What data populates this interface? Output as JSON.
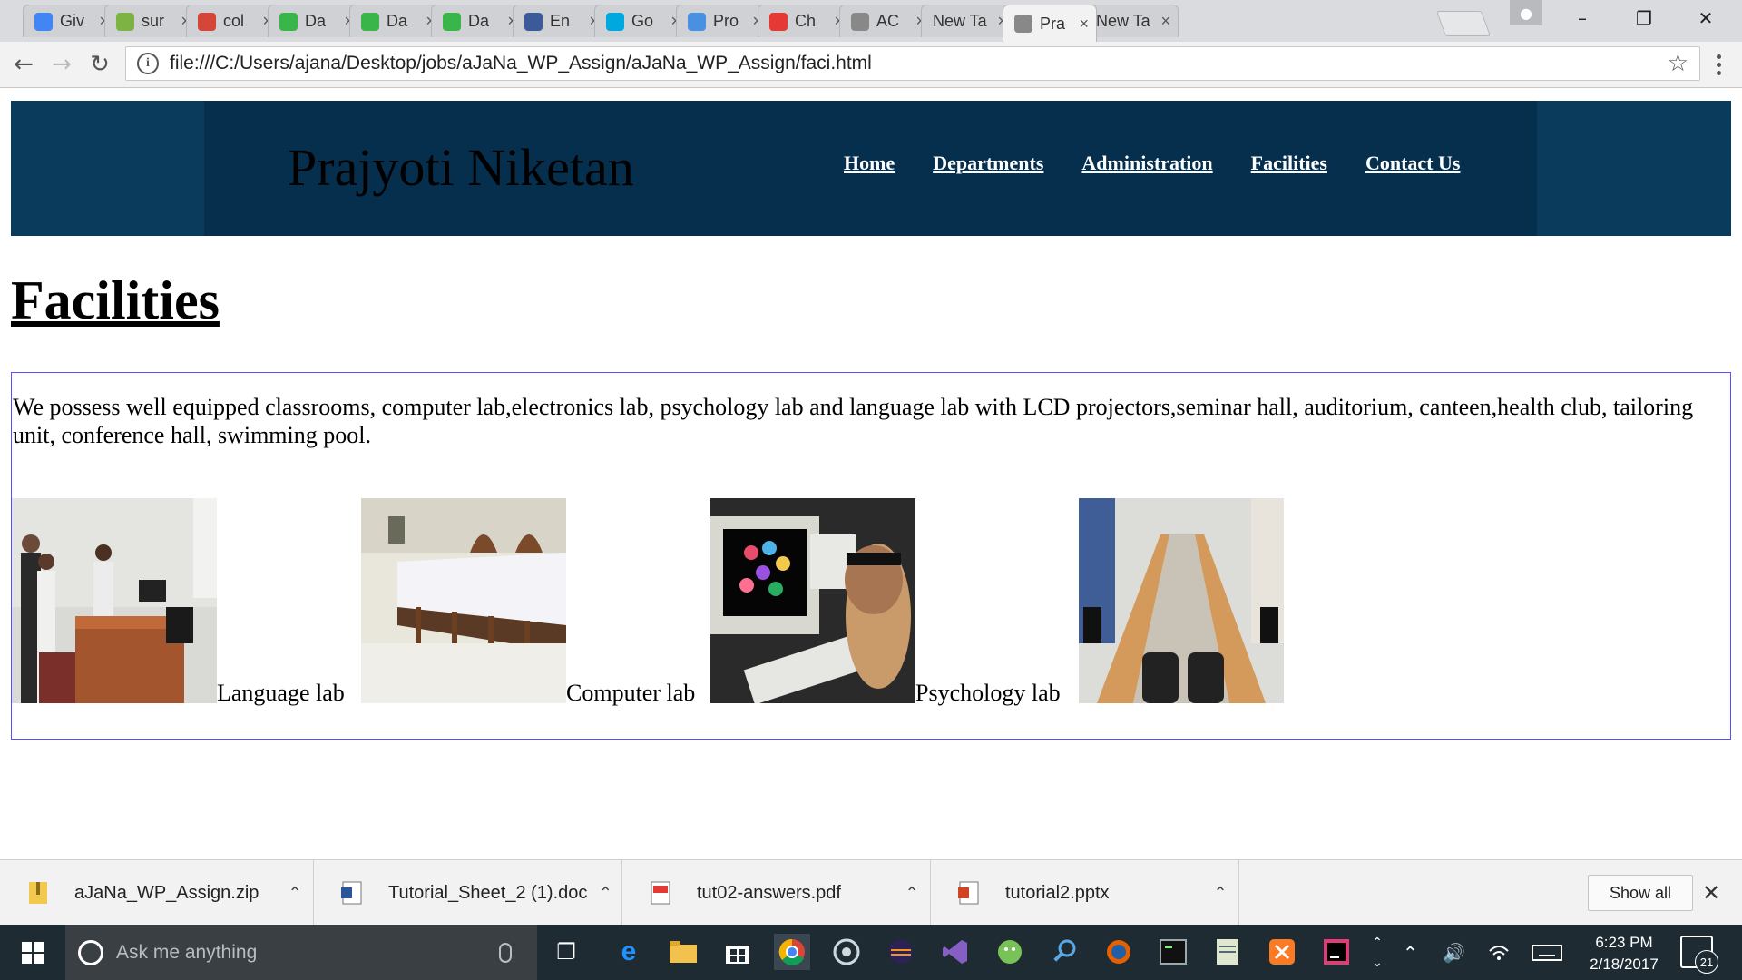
{
  "browser": {
    "tabs": [
      {
        "label": "Giv",
        "icon": "google-icon",
        "color": "#4285f4"
      },
      {
        "label": "sur",
        "icon": "doc-green-icon",
        "color": "#7cb342"
      },
      {
        "label": "col",
        "icon": "gmail-icon",
        "color": "#d44638"
      },
      {
        "label": "Da",
        "icon": "hackerrank-icon",
        "color": "#39b54a"
      },
      {
        "label": "Da",
        "icon": "hackerrank-icon",
        "color": "#39b54a"
      },
      {
        "label": "Da",
        "icon": "hackerrank-icon",
        "color": "#39b54a"
      },
      {
        "label": "En",
        "icon": "next-icon",
        "color": "#3c5a99"
      },
      {
        "label": "Go",
        "icon": "att-icon",
        "color": "#00a8e0"
      },
      {
        "label": "Pro",
        "icon": "w-icon",
        "color": "#4a90e2"
      },
      {
        "label": "Ch",
        "icon": "cross-icon",
        "color": "#e53935"
      },
      {
        "label": "AC",
        "icon": "page-icon",
        "color": "#888888"
      },
      {
        "label": "New Ta",
        "icon": "",
        "color": ""
      },
      {
        "label": "Pra",
        "icon": "page-icon",
        "color": "#888888",
        "active": true
      },
      {
        "label": "New Ta",
        "icon": "",
        "color": ""
      }
    ],
    "tab_close": "×",
    "address": "file:///C:/Users/ajana/Desktop/jobs/aJaNa_WP_Assign/aJaNa_WP_Assign/faci.html"
  },
  "site": {
    "title": "Prajyoti Niketan",
    "nav": [
      "Home",
      "Departments",
      "Administration",
      "Facilities",
      "Contact Us"
    ],
    "heading": "Facilities",
    "paragraph": "We possess well equipped classrooms, computer lab,electronics lab, psychology lab and language lab with LCD projectors,seminar hall, auditorium, canteen,health club, tailoring unit, conference hall, swimming pool.",
    "captions": [
      "Language lab",
      "Computer lab",
      "Psychology lab"
    ],
    "colors": {
      "header": "#0b3b5c",
      "header_inner": "#062f4e",
      "box_border": "#5a4cff"
    }
  },
  "downloads": {
    "items": [
      {
        "name": "aJaNa_WP_Assign.zip",
        "type": "zip"
      },
      {
        "name": "Tutorial_Sheet_2 (1).doc",
        "type": "doc"
      },
      {
        "name": "tut02-answers.pdf",
        "type": "pdf"
      },
      {
        "name": "tutorial2.pptx",
        "type": "pptx"
      }
    ],
    "show_all": "Show all"
  },
  "taskbar": {
    "search_placeholder": "Ask me anything",
    "time": "6:23 PM",
    "date": "2/18/2017",
    "notifications": "21"
  }
}
